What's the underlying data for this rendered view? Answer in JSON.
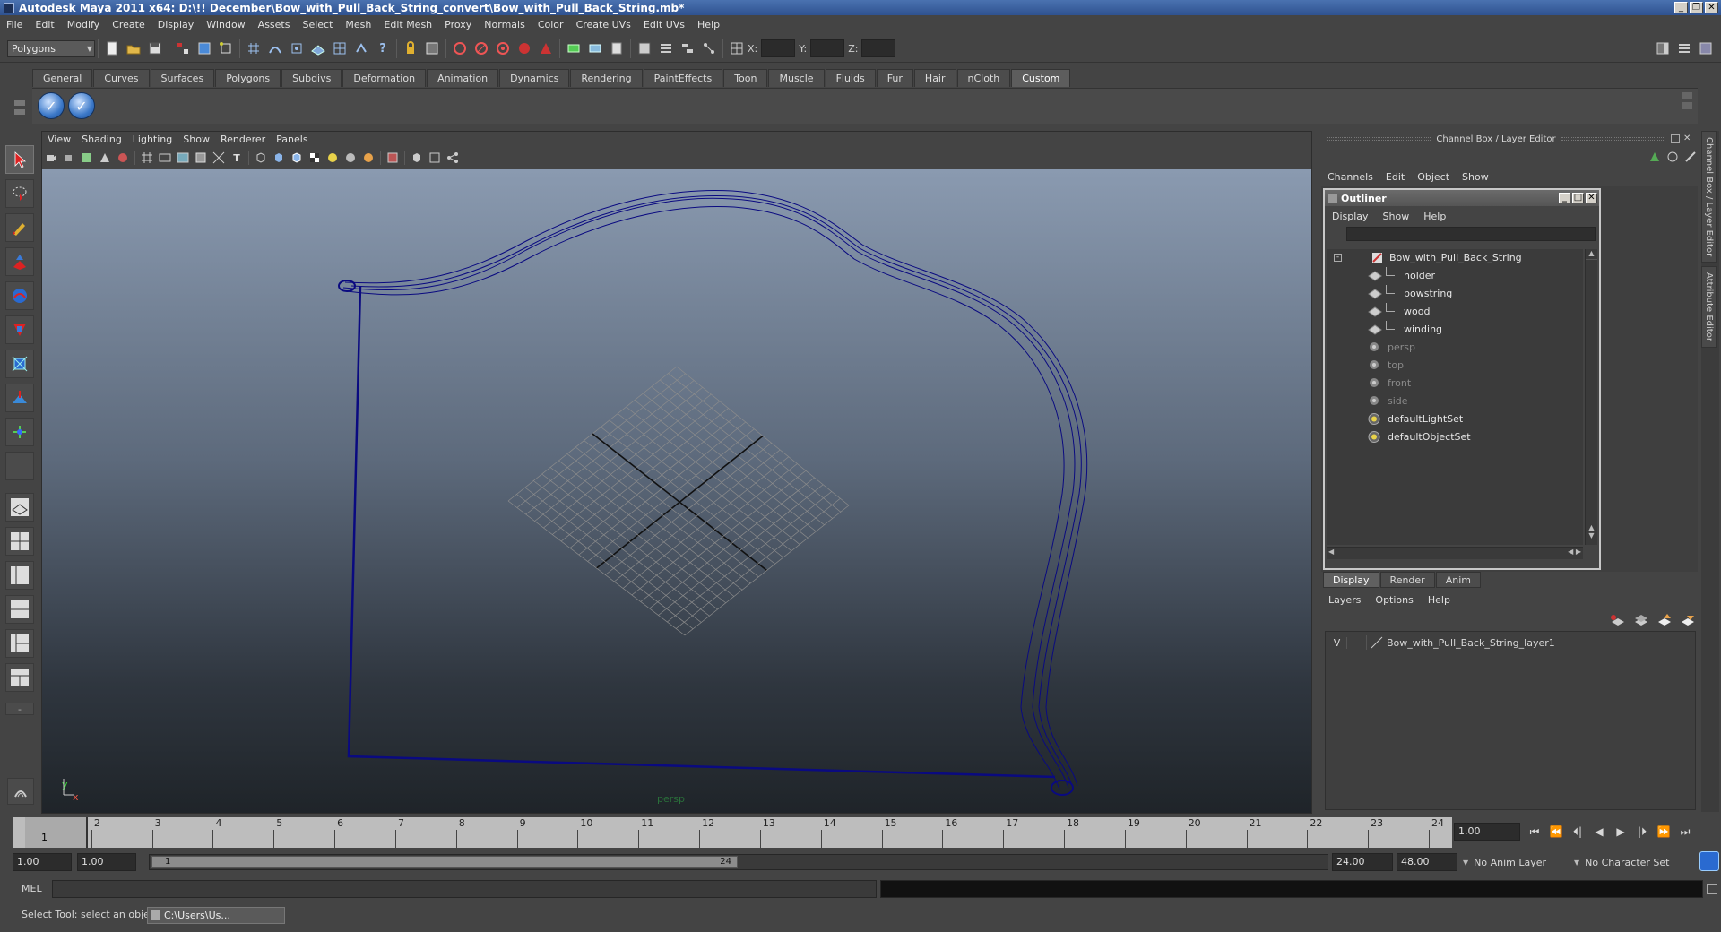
{
  "window": {
    "title": "Autodesk Maya 2011 x64: D:\\!! December\\Bow_with_Pull_Back_String_convert\\Bow_with_Pull_Back_String.mb*",
    "controls": [
      "_",
      "❒",
      "✕"
    ]
  },
  "menubar": [
    "File",
    "Edit",
    "Modify",
    "Create",
    "Display",
    "Window",
    "Assets",
    "Select",
    "Mesh",
    "Edit Mesh",
    "Proxy",
    "Normals",
    "Color",
    "Create UVs",
    "Edit UVs",
    "Help"
  ],
  "statusline": {
    "menu_set": "Polygons",
    "x_label": "X:",
    "y_label": "Y:",
    "z_label": "Z:"
  },
  "shelf": {
    "tabs": [
      "General",
      "Curves",
      "Surfaces",
      "Polygons",
      "Subdivs",
      "Deformation",
      "Animation",
      "Dynamics",
      "Rendering",
      "PaintEffects",
      "Toon",
      "Muscle",
      "Fluids",
      "Fur",
      "Hair",
      "nCloth",
      "Custom"
    ],
    "active_tab": "Custom",
    "buttons": [
      "✓",
      "✓"
    ]
  },
  "viewport": {
    "menu": [
      "View",
      "Shading",
      "Lighting",
      "Show",
      "Renderer",
      "Panels"
    ],
    "camera_label": "persp",
    "axis_y": "y",
    "axis_x": "x",
    "wire_color": "#000080"
  },
  "channel_box": {
    "title": "Channel Box / Layer Editor",
    "menu": [
      "Channels",
      "Edit",
      "Object",
      "Show"
    ]
  },
  "outliner": {
    "title": "Outliner",
    "menu": [
      "Display",
      "Show",
      "Help"
    ],
    "items": [
      {
        "label": "Bow_with_Pull_Back_String",
        "icon": "transform-icon",
        "dim": false,
        "indent": 0
      },
      {
        "label": "holder",
        "icon": "mesh-icon",
        "dim": false,
        "indent": 1
      },
      {
        "label": "bowstring",
        "icon": "mesh-icon",
        "dim": false,
        "indent": 1
      },
      {
        "label": "wood",
        "icon": "mesh-icon",
        "dim": false,
        "indent": 1
      },
      {
        "label": "winding",
        "icon": "mesh-icon",
        "dim": false,
        "indent": 1
      },
      {
        "label": "persp",
        "icon": "camera-icon",
        "dim": true,
        "indent": 0
      },
      {
        "label": "top",
        "icon": "camera-icon",
        "dim": true,
        "indent": 0
      },
      {
        "label": "front",
        "icon": "camera-icon",
        "dim": true,
        "indent": 0
      },
      {
        "label": "side",
        "icon": "camera-icon",
        "dim": true,
        "indent": 0
      },
      {
        "label": "defaultLightSet",
        "icon": "set-icon",
        "dim": false,
        "indent": 0
      },
      {
        "label": "defaultObjectSet",
        "icon": "set-icon",
        "dim": false,
        "indent": 0
      }
    ]
  },
  "layer_editor": {
    "tabs": [
      "Display",
      "Render",
      "Anim"
    ],
    "active_tab": "Display",
    "menu": [
      "Layers",
      "Options",
      "Help"
    ],
    "layer": {
      "visibility": "V",
      "name": "Bow_with_Pull_Back_String_layer1"
    }
  },
  "side_tabs": [
    "Channel Box / Layer Editor",
    "Attribute Editor"
  ],
  "timeline": {
    "ticks": [
      "1",
      "2",
      "3",
      "4",
      "5",
      "6",
      "7",
      "8",
      "9",
      "10",
      "11",
      "12",
      "13",
      "14",
      "15",
      "16",
      "17",
      "18",
      "19",
      "20",
      "21",
      "22",
      "23",
      "24"
    ],
    "current_frame": "1.00",
    "playhead_label": "1",
    "playback": [
      "⏮",
      "⏪",
      "⏴|",
      "◀",
      "▶",
      "|⏵",
      "⏩",
      "⏭"
    ]
  },
  "range": {
    "start": "1.00",
    "playback_start": "1.00",
    "handle_start": "1",
    "handle_end": "24",
    "playback_end": "24.00",
    "end": "48.00",
    "anim_layer": "No Anim Layer",
    "character_set": "No Character Set"
  },
  "command_line": {
    "label": "MEL"
  },
  "help_line": {
    "text": "Select Tool: select an object",
    "task_button": "C:\\Users\\Us..."
  }
}
